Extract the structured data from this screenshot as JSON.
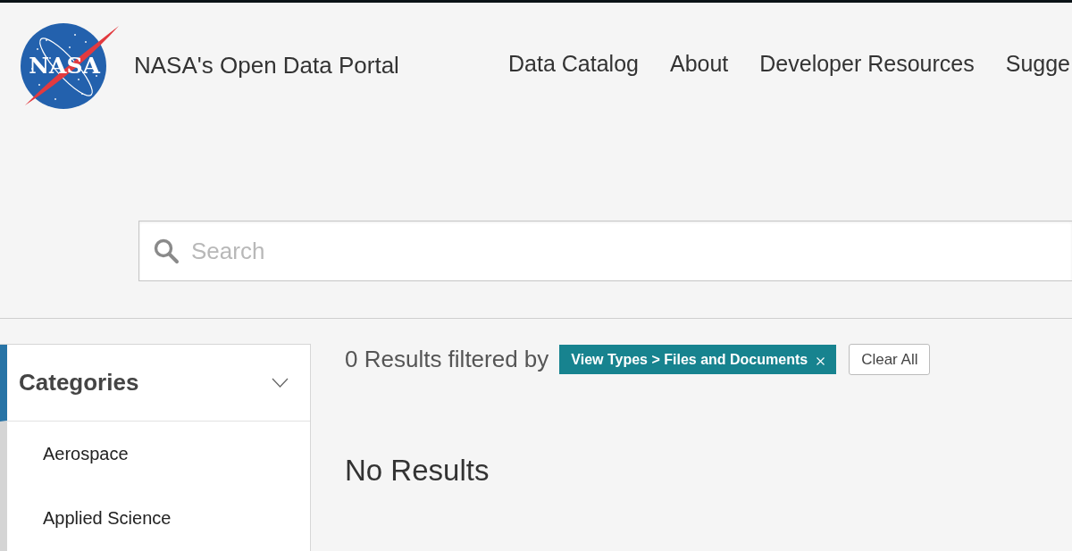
{
  "header": {
    "logo": {
      "text": "NASA"
    },
    "title": "NASA's Open Data Portal",
    "nav": [
      "Data Catalog",
      "About",
      "Developer Resources",
      "Sugge"
    ]
  },
  "search": {
    "placeholder": "Search"
  },
  "sidebar": {
    "sections": [
      {
        "title": "Categories",
        "expanded": true,
        "items": [
          {
            "label": "Aerospace"
          },
          {
            "label": "Applied Science"
          }
        ]
      }
    ]
  },
  "results": {
    "summary": "0 Results filtered by",
    "filters": [
      {
        "label": "View Types > Files and Documents"
      }
    ],
    "clear_button": "Clear All",
    "empty_message": "No Results"
  }
}
